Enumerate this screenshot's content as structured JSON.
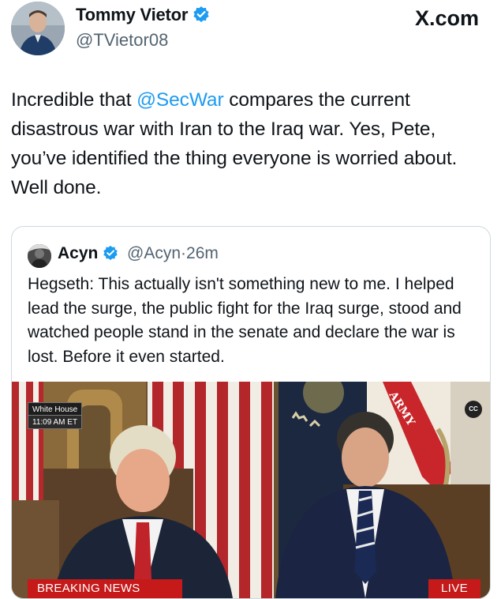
{
  "tweet": {
    "author_name": "Tommy Vietor",
    "author_handle": "@TVietor08",
    "source_badge": "X.com",
    "text_before": "Incredible that ",
    "mention": "@SecWar",
    "text_after": " compares the current disastrous war with Iran to the Iraq war. Yes, Pete, you’ve identified the thing everyone is worried about. Well done.",
    "accent_color": "#1d9bf0"
  },
  "quote": {
    "author_name": "Acyn",
    "author_handle": "@Acyn",
    "separator": "·",
    "time": "26m",
    "text": "Hegseth: This actually isn't something new to me. I helped lead the surge, the public fight for the Iraq surge, stood and watched people stand in the senate and declare the war is lost. Before it even started.",
    "media": {
      "location_tag": "White House",
      "time_tag": "11:09 AM ET",
      "cc_label": "CC",
      "banner_label": "ARMY",
      "breaking_label": "BREAKING NEWS",
      "live_label": "LIVE",
      "banner_color": "#c61a1a"
    }
  },
  "icons": [
    "verified-badge-icon",
    "closed-captions-icon"
  ]
}
